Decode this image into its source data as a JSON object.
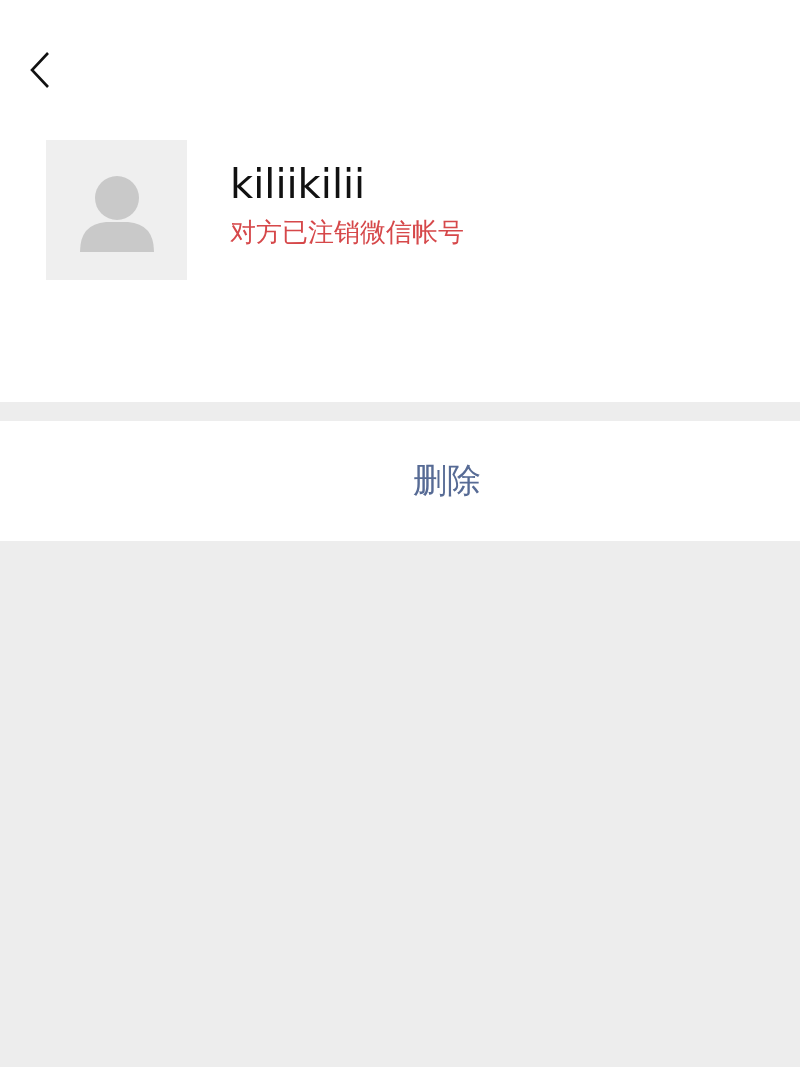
{
  "profile": {
    "name": "kiliikilii",
    "status": "对方已注销微信帐号"
  },
  "actions": [
    {
      "label": "删除",
      "kind": "danger-link"
    }
  ]
}
